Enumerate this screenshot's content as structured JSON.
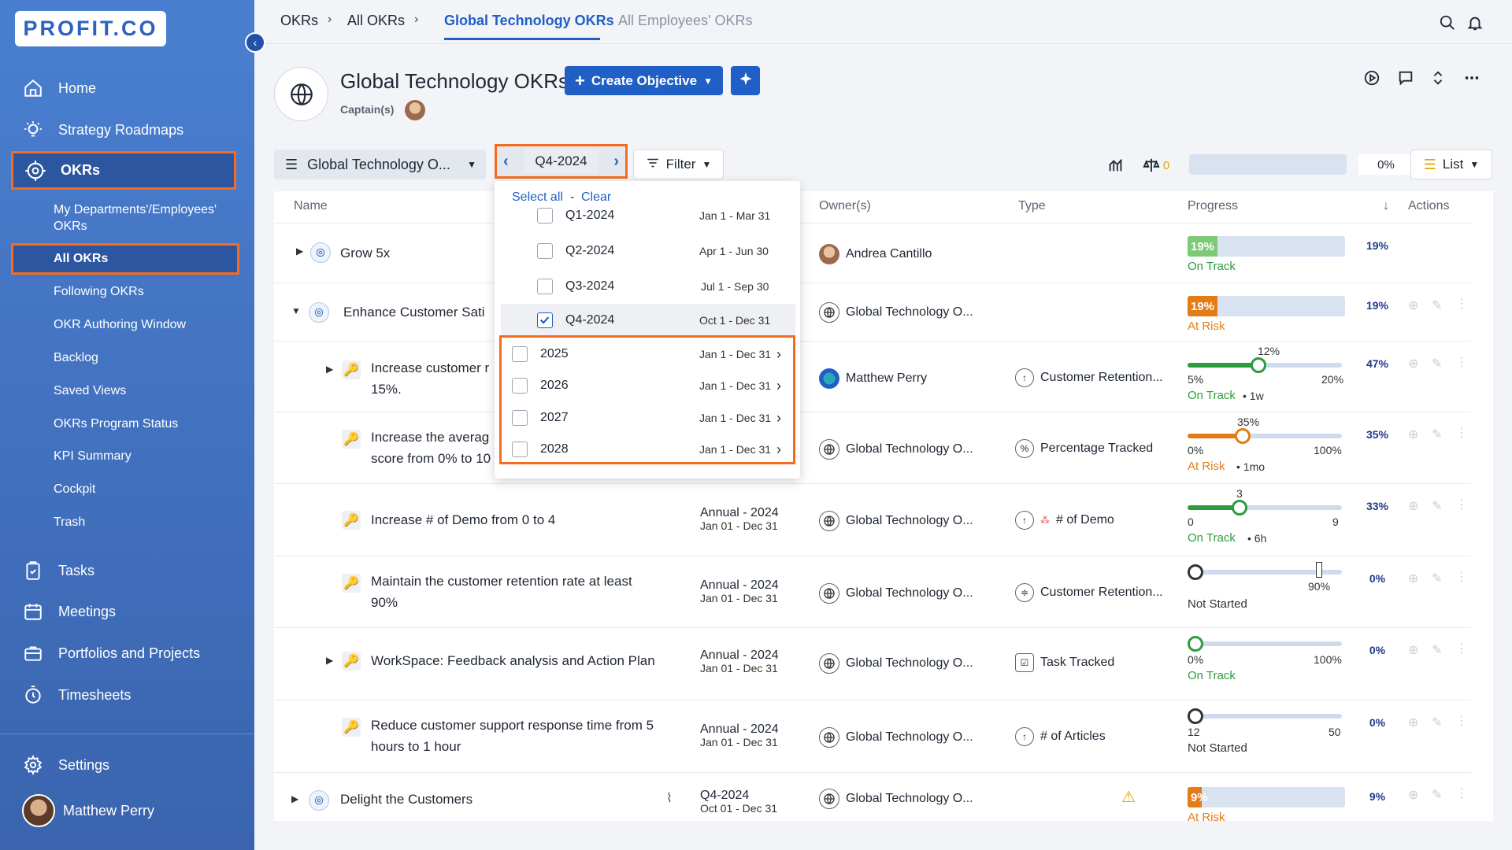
{
  "sidebar": {
    "logo": "PROFIT.CO",
    "nav": [
      {
        "label": "Home",
        "icon": "home-icon"
      },
      {
        "label": "Strategy Roadmaps",
        "icon": "bulb-icon"
      },
      {
        "label": "OKRs",
        "icon": "target-icon"
      }
    ],
    "okr_sub": [
      "My Departments'/Employees' OKRs",
      "All OKRs",
      "Following OKRs",
      "OKR Authoring Window",
      "Backlog",
      "Saved Views",
      "OKRs Program Status",
      "KPI Summary",
      "Cockpit",
      "Trash"
    ],
    "nav2": [
      "Tasks",
      "Meetings",
      "Portfolios and Projects",
      "Timesheets"
    ],
    "settings": "Settings",
    "user": "Matthew Perry"
  },
  "topbar": {
    "crumbs": [
      "OKRs",
      "All OKRs"
    ],
    "active_tab": "Global Technology OKRs",
    "other_tab": "All Employees' OKRs"
  },
  "header": {
    "title": "Global Technology OKRs",
    "create_label": "Create Objective",
    "captain_label": "Captain(s)"
  },
  "toolbar": {
    "team": "Global Technology O...",
    "period": "Q4-2024",
    "filter": "Filter",
    "warning_count": "0",
    "overall_pct": "0%",
    "view": "List"
  },
  "dropdown": {
    "select_all": "Select all",
    "sep": "-",
    "clear": "Clear",
    "quarters": [
      {
        "label": "Q1-2024",
        "range": "Jan 1 - Mar 31",
        "checked": false
      },
      {
        "label": "Q2-2024",
        "range": "Apr 1 - Jun 30",
        "checked": false
      },
      {
        "label": "Q3-2024",
        "range": "Jul 1 - Sep 30",
        "checked": false
      },
      {
        "label": "Q4-2024",
        "range": "Oct 1 - Dec 31",
        "checked": true
      }
    ],
    "years": [
      {
        "label": "2025",
        "range": "Jan 1 - Dec 31"
      },
      {
        "label": "2026",
        "range": "Jan 1 - Dec 31"
      },
      {
        "label": "2027",
        "range": "Jan 1 - Dec 31"
      },
      {
        "label": "2028",
        "range": "Jan 1 - Dec 31"
      }
    ]
  },
  "table": {
    "headers": {
      "name": "Name",
      "owners": "Owner(s)",
      "type": "Type",
      "progress": "Progress",
      "actions": "Actions"
    },
    "rows": [
      {
        "name": "Grow 5x",
        "owner": "Andrea Cantillo",
        "progress": 19,
        "progress_label": "19%",
        "pct": "19%",
        "status": "On Track"
      },
      {
        "name": "Enhance Customer Sati",
        "owner": "Global Technology O...",
        "progress": 19,
        "progress_label": "19%",
        "pct": "19%",
        "status": "At Risk"
      },
      {
        "name1": "Increase customer r",
        "name2": "15%.",
        "owner": "Matthew Perry",
        "type": "Customer Retention...",
        "pct": "47%",
        "val": "12%",
        "min": "5%",
        "max": "20%",
        "status": "On Track",
        "ago": "• 1w",
        "level": 0.47
      },
      {
        "name1": "Increase the averag",
        "name2": "score from 0% to 10",
        "owner": "Global Technology O...",
        "type": "Percentage Tracked",
        "pct": "35%",
        "val": "35%",
        "min": "0%",
        "max": "100%",
        "status": "At Risk",
        "ago": "• 1mo",
        "level": 0.35
      },
      {
        "name": "Increase # of Demo from 0 to 4",
        "period": "Annual - 2024",
        "range": "Jan 01 - Dec 31",
        "owner": "Global Technology O...",
        "type": "# of Demo",
        "pct": "33%",
        "val": "3",
        "min": "0",
        "max": "9",
        "status": "On Track",
        "ago": "• 6h",
        "level": 0.33
      },
      {
        "name1": "Maintain the customer retention rate at least",
        "name2": "90%",
        "period": "Annual - 2024",
        "range": "Jan 01 - Dec 31",
        "owner": "Global Technology O...",
        "type": "Customer Retention...",
        "pct": "0%",
        "target": "90%",
        "status": "Not Started"
      },
      {
        "name": "WorkSpace: Feedback analysis and Action Plan",
        "period": "Annual - 2024",
        "range": "Jan 01 - Dec 31",
        "owner": "Global Technology O...",
        "type": "Task Tracked",
        "pct": "0%",
        "min": "0%",
        "max": "100%",
        "status": "On Track"
      },
      {
        "name1": "Reduce customer support response time from 5",
        "name2": "hours to 1 hour",
        "period": "Annual - 2024",
        "range": "Jan 01 - Dec 31",
        "owner": "Global Technology O...",
        "type": "# of Articles",
        "pct": "0%",
        "min": "12",
        "max": "50",
        "status": "Not Started"
      },
      {
        "name": "Delight the Customers",
        "period": "Q4-2024",
        "range": "Oct 01 - Dec 31",
        "owner": "Global Technology O...",
        "progress": 9,
        "progress_label": "9%",
        "pct": "9%",
        "status": "At Risk"
      }
    ]
  },
  "colors": {
    "accent": "#1f5fc6",
    "on_track": "#2e9b3e",
    "at_risk": "#e57b16",
    "highlight": "#f36c21"
  }
}
